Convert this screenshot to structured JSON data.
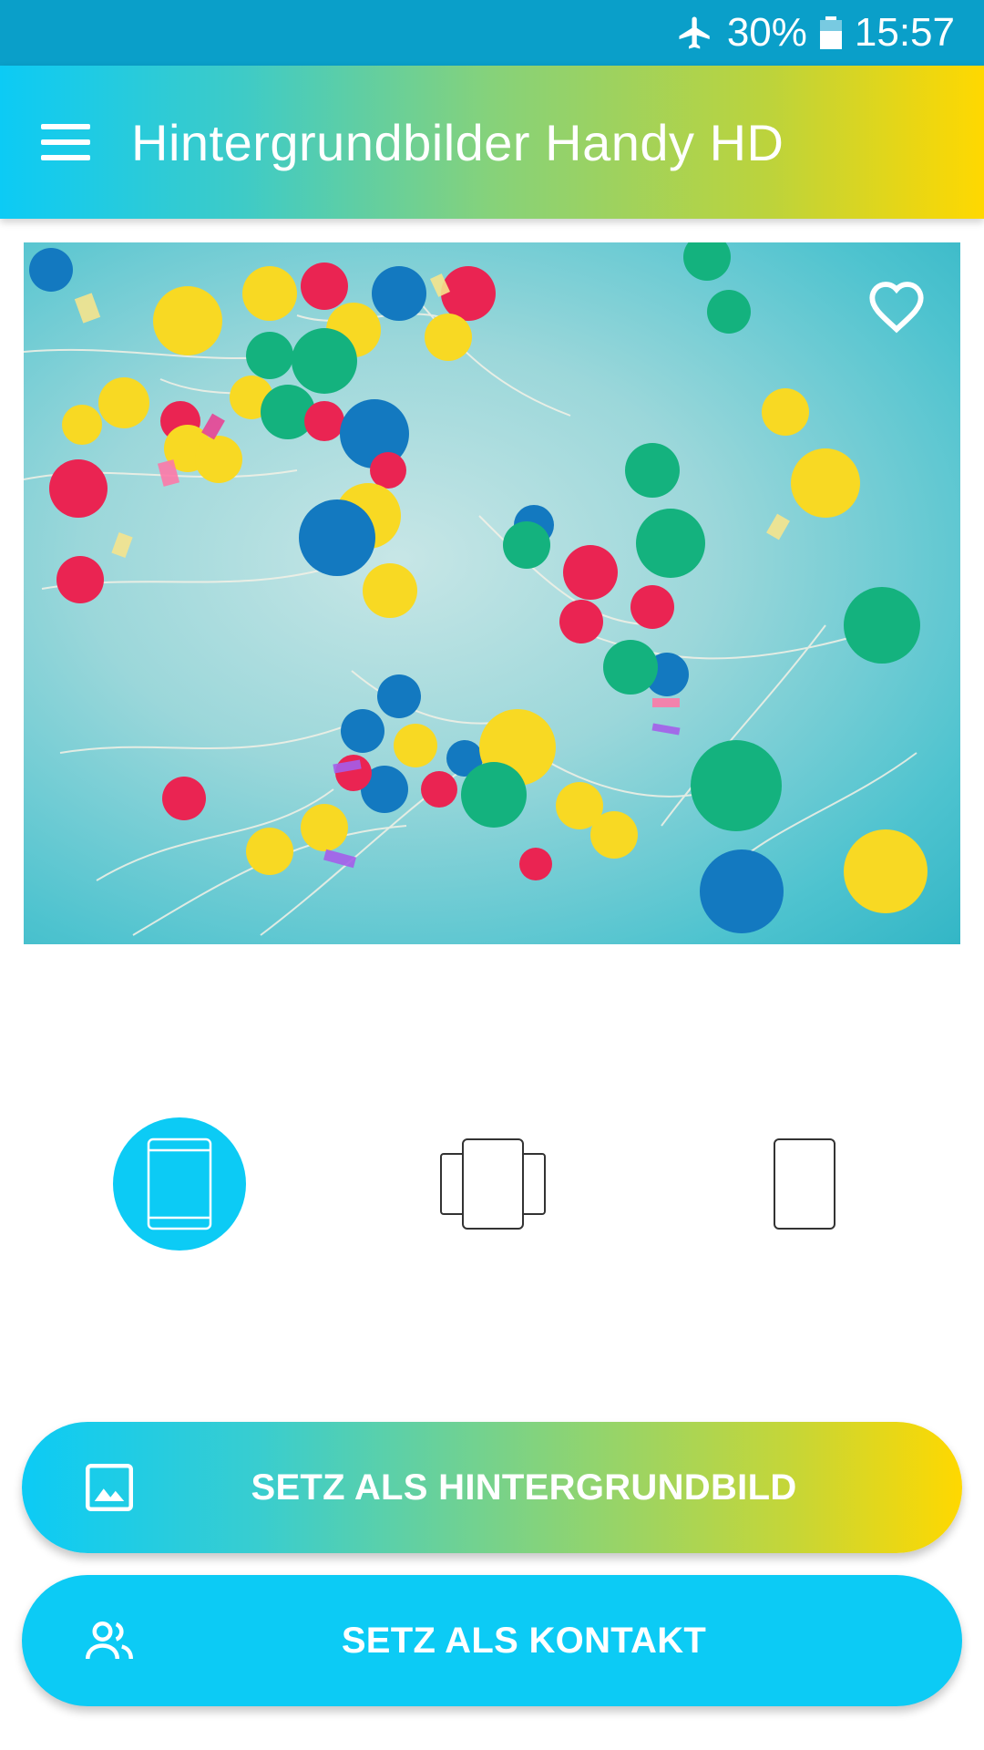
{
  "status_bar": {
    "battery": "30%",
    "time": "15:57",
    "icons": [
      "airplane-icon",
      "battery-icon"
    ]
  },
  "app_bar": {
    "title": "Hintergrundbilder Handy HD",
    "menu_icon": "hamburger-menu-icon"
  },
  "image": {
    "subject": "balloons",
    "favorite_icon": "heart-outline-icon"
  },
  "wallpaper_modes": {
    "options": [
      "fit-screen",
      "scrolling",
      "fixed"
    ],
    "selected": "fit-screen",
    "icons": [
      "tablet-icon",
      "multi-page-icon",
      "phone-outline-icon"
    ]
  },
  "actions": {
    "set_wallpaper": {
      "label": "SETZ ALS HINTERGRUNDBILD",
      "icon": "image-icon"
    },
    "set_contact": {
      "label": "SETZ ALS KONTAKT",
      "icon": "contacts-icon"
    }
  },
  "colors": {
    "status_bar": "#0a9fc9",
    "accent_cyan": "#0ccbf5",
    "accent_yellow": "#ffd800",
    "balloon_red": "#ea2452",
    "balloon_yellow": "#f8d923",
    "balloon_green": "#14b27e",
    "balloon_blue": "#1379c0"
  }
}
